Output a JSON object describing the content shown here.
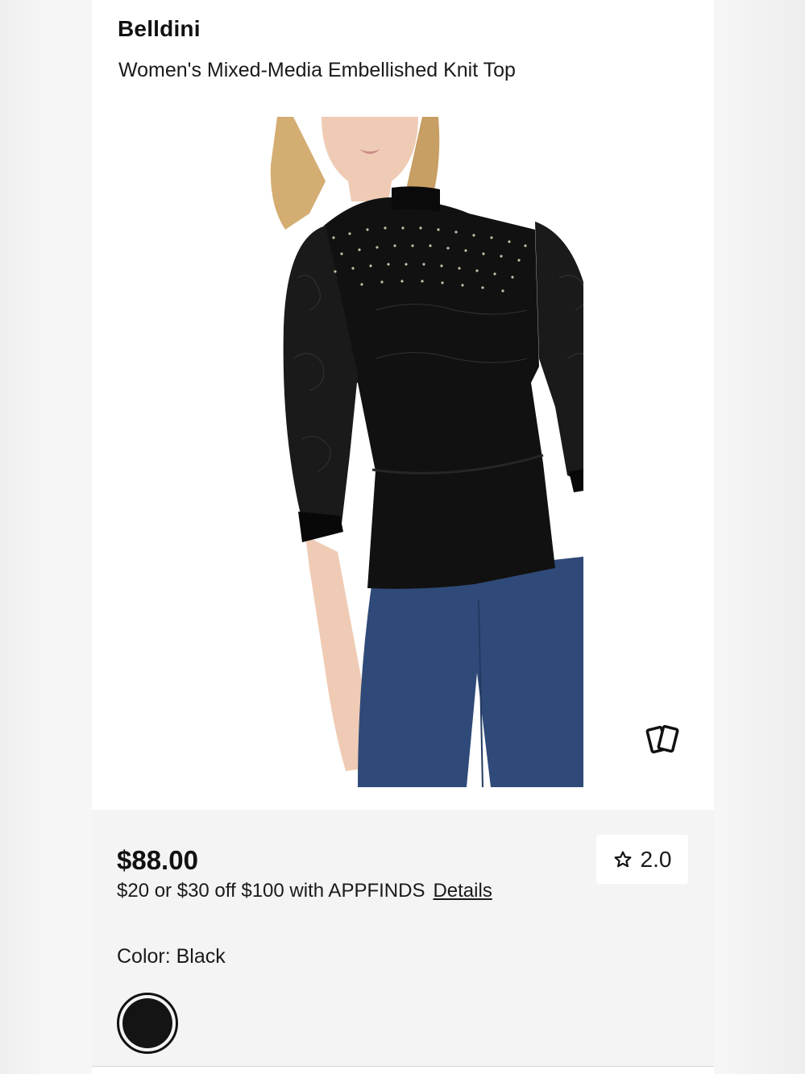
{
  "product": {
    "brand": "Belldini",
    "title": "Women's Mixed-Media Embellished Knit Top",
    "price": "$88.00",
    "promo_text": "$20 or $30 off $100 with APPFINDS",
    "promo_link": "Details",
    "rating": "2.0",
    "color_label": "Color: Black",
    "swatch_color": "#141414"
  },
  "icons": {
    "view_more": "cards-icon",
    "rating": "star-outline-icon"
  }
}
